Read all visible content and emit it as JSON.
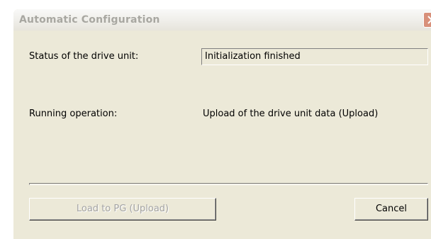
{
  "window": {
    "title": "Automatic Configuration",
    "close_icon": "close-icon"
  },
  "status": {
    "label": "Status of the drive unit:",
    "value": "Initialization finished"
  },
  "operation": {
    "label": "Running operation:",
    "value": "Upload of the drive unit data (Upload)"
  },
  "progress": {
    "value": 0
  },
  "buttons": {
    "load_label": "Load to PG (Upload)",
    "cancel_label": "Cancel"
  },
  "colors": {
    "dialog_background": "#ece9d8",
    "title_text": "#a8a7a1",
    "disabled_text": "#a3a3a3",
    "close_button": "#d8907a"
  }
}
